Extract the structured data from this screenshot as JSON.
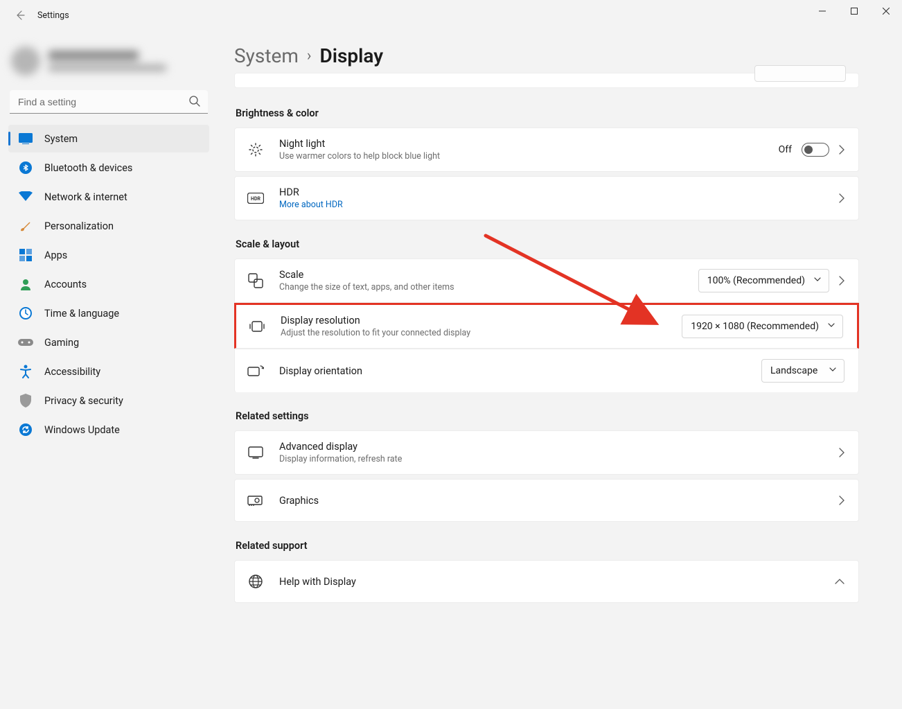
{
  "app_title": "Settings",
  "search_placeholder": "Find a setting",
  "nav": [
    {
      "label": "System",
      "selected": true
    },
    {
      "label": "Bluetooth & devices"
    },
    {
      "label": "Network & internet"
    },
    {
      "label": "Personalization"
    },
    {
      "label": "Apps"
    },
    {
      "label": "Accounts"
    },
    {
      "label": "Time & language"
    },
    {
      "label": "Gaming"
    },
    {
      "label": "Accessibility"
    },
    {
      "label": "Privacy & security"
    },
    {
      "label": "Windows Update"
    }
  ],
  "breadcrumb": {
    "parent": "System",
    "current": "Display"
  },
  "sections": {
    "brightness": {
      "heading": "Brightness & color",
      "nightlight": {
        "title": "Night light",
        "sub": "Use warmer colors to help block blue light",
        "state_label": "Off"
      },
      "hdr": {
        "title": "HDR",
        "link": "More about HDR"
      }
    },
    "scale": {
      "heading": "Scale & layout",
      "scale_row": {
        "title": "Scale",
        "sub": "Change the size of text, apps, and other items",
        "value": "100% (Recommended)"
      },
      "resolution_row": {
        "title": "Display resolution",
        "sub": "Adjust the resolution to fit your connected display",
        "value": "1920 × 1080 (Recommended)"
      },
      "orientation_row": {
        "title": "Display orientation",
        "value": "Landscape"
      }
    },
    "related": {
      "heading": "Related settings",
      "advanced": {
        "title": "Advanced display",
        "sub": "Display information, refresh rate"
      },
      "graphics": {
        "title": "Graphics"
      }
    },
    "support": {
      "heading": "Related support",
      "help": {
        "title": "Help with Display"
      }
    }
  }
}
